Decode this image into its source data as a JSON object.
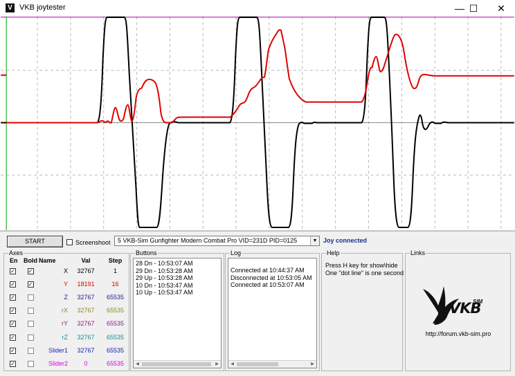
{
  "window": {
    "title": "VKB joytester",
    "minimize": "—",
    "maximize": "☐",
    "close": "✕"
  },
  "toolbar": {
    "start_label": "START",
    "screenshoot_label": "Screenshoot",
    "screenshoot_checked": false,
    "device_selected": "5  VKB-Sim Gunfighter Modern Combat Pro  VID=231D PID=0125",
    "status": "Joy connected"
  },
  "axes": {
    "title": "Axes",
    "headers": {
      "en": "En",
      "bold": "Bold",
      "name": "Name",
      "val": "Val",
      "step": "Step"
    },
    "rows": [
      {
        "name": "X",
        "val": "32767",
        "step": "1",
        "en": true,
        "bold": true,
        "color": "#000000"
      },
      {
        "name": "Y",
        "val": "18191",
        "step": "16",
        "en": true,
        "bold": true,
        "color": "#e00000"
      },
      {
        "name": "Z",
        "val": "32767",
        "step": "65535",
        "en": true,
        "bold": false,
        "color": "#1c1c8c"
      },
      {
        "name": "rX",
        "val": "32767",
        "step": "65535",
        "en": true,
        "bold": false,
        "color": "#8c8c1c"
      },
      {
        "name": "rY",
        "val": "32767",
        "step": "65535",
        "en": true,
        "bold": false,
        "color": "#8c1c8c"
      },
      {
        "name": "rZ",
        "val": "32767",
        "step": "65535",
        "en": true,
        "bold": false,
        "color": "#1c8c8c"
      },
      {
        "name": "Slider1",
        "val": "32767",
        "step": "65535",
        "en": true,
        "bold": false,
        "color": "#1c1ca8"
      },
      {
        "name": "Slider2",
        "val": "0",
        "step": "65535",
        "en": true,
        "bold": false,
        "color": "#e000e0"
      }
    ]
  },
  "buttons": {
    "title": "Buttons",
    "items": [
      "28 Dn - 10:53:07 AM",
      "29 Dn - 10:53:28 AM",
      "29 Up - 10:53:28 AM",
      "10 Dn - 10:53:47 AM",
      "10 Up - 10:53:47 AM"
    ]
  },
  "log": {
    "title": "Log",
    "items": [
      "Connected at 10:44:37 AM",
      "Disconnected at 10:53:05 AM",
      "Connected at 10:53:07 AM"
    ]
  },
  "help": {
    "title": "Help",
    "lines": [
      "Press H key for show\\hide",
      "One \"dot line\" is one second"
    ]
  },
  "links": {
    "title": "Links",
    "logo_text": "VKB",
    "logo_superscript": "SIM",
    "url": "http://forum.vkb-sim.pro"
  },
  "colors": {
    "x_trace": "#000000",
    "y_trace": "#e00000",
    "top_line": "#e000e0",
    "left_line": "#00a000"
  }
}
